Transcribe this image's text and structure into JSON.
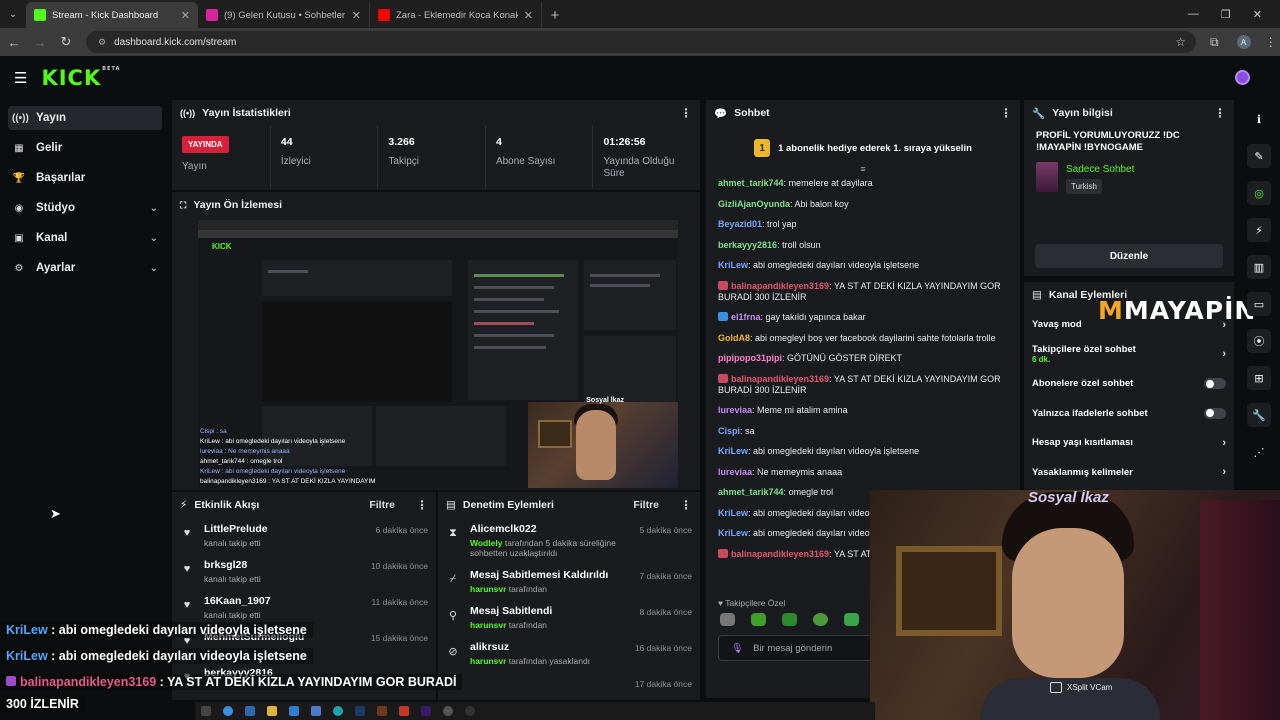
{
  "browser": {
    "tabs": [
      {
        "title": "Stream - Kick Dashboard",
        "color": "#53fc18",
        "active": true
      },
      {
        "title": "(9) Gelen Kutusu • Sohbetler",
        "color": "#d6249f",
        "active": false
      },
      {
        "title": "Zara - Eklemedir Koca Konak -",
        "color": "#ff0000",
        "active": false
      }
    ],
    "url": "dashboard.kick.com/stream",
    "avatar_letter": "A"
  },
  "kick": {
    "logo": "KICK",
    "beta": "BETA"
  },
  "sidebar": {
    "items": [
      {
        "label": "Yayın",
        "icon": "stream-icon",
        "glyph": "((•))",
        "active": true,
        "chevron": false
      },
      {
        "label": "Gelir",
        "icon": "revenue-icon",
        "glyph": "▦",
        "active": false,
        "chevron": false
      },
      {
        "label": "Başarılar",
        "icon": "trophy-icon",
        "glyph": "🏆",
        "active": false,
        "chevron": false
      },
      {
        "label": "Stüdyo",
        "icon": "studio-icon",
        "glyph": "◉",
        "active": false,
        "chevron": true
      },
      {
        "label": "Kanal",
        "icon": "channel-icon",
        "glyph": "▣",
        "active": false,
        "chevron": true
      },
      {
        "label": "Ayarlar",
        "icon": "settings-icon",
        "glyph": "⚙",
        "active": false,
        "chevron": true
      }
    ]
  },
  "stats": {
    "title": "Yayın İstatistikleri",
    "live_badge": "YAYINDA",
    "live_label": "Yayın",
    "items": [
      {
        "value": "44",
        "label": "İzleyici"
      },
      {
        "value": "3.266",
        "label": "Takipçi"
      },
      {
        "value": "4",
        "label": "Abone Sayısı"
      },
      {
        "value": "01:26:56",
        "label": "Yayında Olduğu Süre"
      }
    ]
  },
  "preview": {
    "title": "Yayın Ön İzlemesi",
    "mini_tag": "Sosyal İkaz",
    "mini_chat": [
      "Cispi : sa",
      "KriLew : abi omegledeki dayıları videoyla işletsene",
      "lureviaa : Ne memeymis anaaa",
      "ahmet_tarik744 : omegle trol",
      "KriLew : abi omegledeki dayıları videoyla işletsene",
      "balinapandikleyen3169 : YA ST AT DEKİ KIZLA YAYINDAYIM"
    ]
  },
  "activity": {
    "title": "Etkinlik Akışı",
    "filter": "Filtre",
    "items": [
      {
        "name": "LittlePrelude",
        "sub": "kanalı takip etti",
        "time": "6 dakika önce"
      },
      {
        "name": "brksgl28",
        "sub": "kanalı takip etti",
        "time": "10 dakika önce"
      },
      {
        "name": "16Kaan_1907",
        "sub": "kanalı takip etti",
        "time": "11 dakika önce"
      },
      {
        "name": "MehmetSurmelioglu",
        "sub": "",
        "time": "15 dakika önce"
      },
      {
        "name": "berkayyy2816",
        "sub": "",
        "time": ""
      }
    ]
  },
  "moderation": {
    "title": "Denetim Eylemleri",
    "filter": "Filtre",
    "items": [
      {
        "name": "Alicemclk022",
        "actor": "Wodlely",
        "sub": "tarafından 5 dakika süreliğine sohbetten uzaklaştırıldı",
        "time": "5 dakika önce",
        "icon": "hourglass-icon",
        "glyph": "⧗"
      },
      {
        "name": "Mesaj Sabitlemesi Kaldırıldı",
        "actor": "harunsvr",
        "sub": "tarafından",
        "time": "7 dakika önce",
        "icon": "unpin-icon",
        "glyph": "⌿"
      },
      {
        "name": "Mesaj Sabitlendi",
        "actor": "harunsvr",
        "sub": "tarafından",
        "time": "8 dakika önce",
        "icon": "pin-icon",
        "glyph": "⚲"
      },
      {
        "name": "alikrsuz",
        "actor": "harunsvr",
        "sub": "tarafından yasaklandı",
        "time": "16 dakika önce",
        "icon": "ban-icon",
        "glyph": "⊘"
      },
      {
        "name": "",
        "actor": "",
        "sub": "",
        "time": "17 dakika önce",
        "icon": "ban-icon",
        "glyph": ""
      }
    ]
  },
  "chat": {
    "title": "Sohbet",
    "pinned_rank": "1",
    "pinned": "1 abonelik hediye ederek 1. sıraya yükselin",
    "messages": [
      {
        "user": "ahmet_tarik744",
        "color": "#7be08a",
        "badge": "",
        "text": "memelere at dayilara"
      },
      {
        "user": "GizliAjanOyunda",
        "color": "#7be08a",
        "badge": "",
        "text": "Abi balon koy"
      },
      {
        "user": "Beyazid01",
        "color": "#6ea8ff",
        "badge": "",
        "text": "trol yap"
      },
      {
        "user": "berkayyy2816",
        "color": "#7be08a",
        "badge": "",
        "text": "troll olsun"
      },
      {
        "user": "KriLew",
        "color": "#6ea8ff",
        "badge": "",
        "text": "abi omegledeki dayıları videoyla işletsene"
      },
      {
        "user": "balinapandikleyen3169",
        "color": "#e2546f",
        "badge": "gift",
        "text": "YA ST AT DEKİ KIZLA YAYINDAYIM GOR BURADİ 300 İZLENİR"
      },
      {
        "user": "el1frna",
        "color": "#c58af9",
        "badge": "blue",
        "text": "gay takıldı yapınca bakar"
      },
      {
        "user": "GoldA8",
        "color": "#f0b42a",
        "badge": "",
        "text": "abi omegleyi boş ver facebook dayilarini sahte fotolarla trolle"
      },
      {
        "user": "pipipopo31pipi",
        "color": "#ff7fd0",
        "badge": "",
        "text": "GÖTÜNÜ GÖSTER DİREKT"
      },
      {
        "user": "balinapandikleyen3169",
        "color": "#e2546f",
        "badge": "gift",
        "text": "YA ST AT DEKİ KIZLA YAYINDAYIM GOR BURADİ 300 İZLENİR"
      },
      {
        "user": "lureviaa",
        "color": "#c58af9",
        "badge": "",
        "text": "Meme mi atalim amina"
      },
      {
        "user": "Cispi",
        "color": "#6ea8ff",
        "badge": "",
        "text": "sa"
      },
      {
        "user": "KriLew",
        "color": "#6ea8ff",
        "badge": "",
        "text": "abi omegledeki dayıları videoyla işletsene"
      },
      {
        "user": "lureviaa",
        "color": "#c58af9",
        "badge": "",
        "text": "Ne memeymis anaaa"
      },
      {
        "user": "ahmet_tarik744",
        "color": "#7be08a",
        "badge": "",
        "text": "omegle trol"
      },
      {
        "user": "KriLew",
        "color": "#6ea8ff",
        "badge": "",
        "text": "abi omegledeki dayıları video"
      },
      {
        "user": "KriLew",
        "color": "#6ea8ff",
        "badge": "",
        "text": "abi omegledeki dayıları video"
      },
      {
        "user": "balinapandikleyen3169",
        "color": "#e2546f",
        "badge": "gift",
        "text": "YA ST AT D BURADİ 300 İZLENİR"
      }
    ],
    "followers_only_label": "Takipçilere Özel",
    "input_placeholder": "Bir mesaj gönderin"
  },
  "info": {
    "title": "Yayın bilgisi",
    "stream_title": "PROFİL YORUMLUYORUZZ !DC !MAYAPİN !BYNOGAME",
    "category": "Sadece Sohbet",
    "language": "Turkish",
    "edit_label": "Düzenle"
  },
  "channel_actions": {
    "title": "Kanal Eylemleri",
    "items": [
      {
        "label": "Yavaş mod",
        "sub": "",
        "control": "chevron"
      },
      {
        "label": "Takipçilere özel sohbet",
        "sub": "6 dk.",
        "control": "chevron"
      },
      {
        "label": "Abonelere özel sohbet",
        "sub": "",
        "control": "toggle"
      },
      {
        "label": "Yalnızca ifadelerle sohbet",
        "sub": "",
        "control": "toggle"
      },
      {
        "label": "Hesap yaşı kısıtlaması",
        "sub": "",
        "control": "chevron"
      },
      {
        "label": "Yasaklanmış kelimeler",
        "sub": "",
        "control": "chevron"
      }
    ],
    "sponsor_logo": "MAYAPİN"
  },
  "webcam": {
    "overlay_title": "Sosyal İkaz",
    "source": "XSplit VCam"
  },
  "overlay_chat": [
    {
      "user": "KriLew",
      "sep": " : ",
      "text": "abi omegledeki dayıları videoyla işletsene",
      "style": "un"
    },
    {
      "user": "KriLew",
      "sep": " : ",
      "text": "abi omegledeki dayıları videoyla işletsene",
      "style": "un"
    },
    {
      "user": "balinapandikleyen3169",
      "sep": " : ",
      "text": "YA ST AT DEKİ KIZLA YAYINDAYIM GOR BURADİ",
      "style": "un2"
    },
    {
      "user": "",
      "sep": "",
      "text": "300 İZLENİR",
      "style": "un"
    }
  ]
}
